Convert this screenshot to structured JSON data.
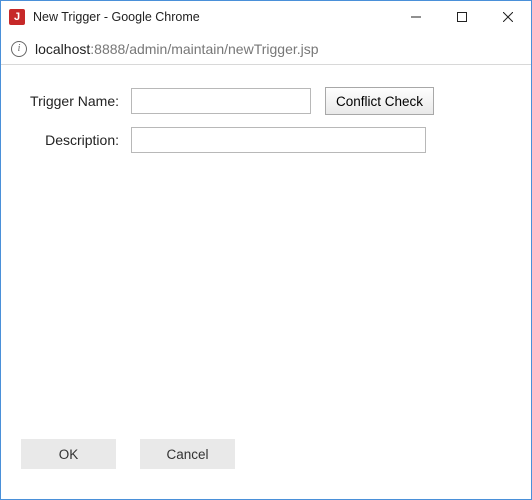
{
  "window": {
    "title": "New Trigger - Google Chrome",
    "app_icon_letter": "J"
  },
  "address": {
    "host": "localhost",
    "rest": ":8888/admin/maintain/newTrigger.jsp"
  },
  "form": {
    "trigger_name_label": "Trigger Name:",
    "trigger_name_value": "",
    "conflict_check_label": "Conflict Check",
    "description_label": "Description:",
    "description_value": ""
  },
  "buttons": {
    "ok": "OK",
    "cancel": "Cancel"
  }
}
